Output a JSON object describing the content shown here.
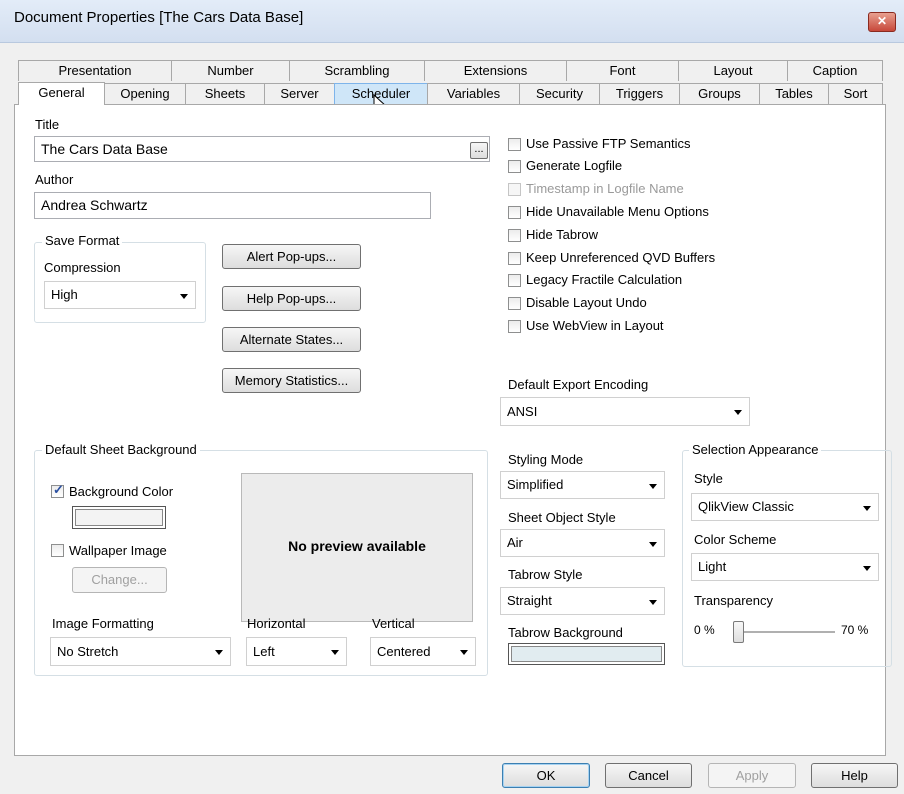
{
  "window": {
    "title": "Document Properties [The Cars Data Base]",
    "close_label": "✕"
  },
  "tabs_row1": [
    "Presentation",
    "Number",
    "Scrambling",
    "Extensions",
    "Font",
    "Layout",
    "Caption"
  ],
  "tabs_row2": [
    "General",
    "Opening",
    "Sheets",
    "Server",
    "Scheduler",
    "Variables",
    "Security",
    "Triggers",
    "Groups",
    "Tables",
    "Sort"
  ],
  "active_tab": "General",
  "hover_tab": "Scheduler",
  "general": {
    "title_label": "Title",
    "title_value": "The Cars Data Base",
    "browse_label": "...",
    "author_label": "Author",
    "author_value": "Andrea Schwartz",
    "save_format": {
      "legend": "Save Format",
      "compression_label": "Compression",
      "compression_value": "High"
    },
    "buttons": {
      "alert": "Alert Pop-ups...",
      "help": "Help Pop-ups...",
      "alternate": "Alternate States...",
      "memory": "Memory Statistics..."
    },
    "options": [
      {
        "label": "Use Passive FTP Semantics",
        "checked": false,
        "enabled": true
      },
      {
        "label": "Generate Logfile",
        "checked": false,
        "enabled": true
      },
      {
        "label": "Timestamp in Logfile Name",
        "checked": false,
        "enabled": false
      },
      {
        "label": "Hide Unavailable Menu Options",
        "checked": false,
        "enabled": true
      },
      {
        "label": "Hide Tabrow",
        "checked": false,
        "enabled": true
      },
      {
        "label": "Keep Unreferenced QVD Buffers",
        "checked": false,
        "enabled": true
      },
      {
        "label": "Legacy Fractile Calculation",
        "checked": false,
        "enabled": true
      },
      {
        "label": "Disable Layout Undo",
        "checked": false,
        "enabled": true
      },
      {
        "label": "Use WebView in Layout",
        "checked": false,
        "enabled": true
      }
    ],
    "export_encoding": {
      "label": "Default Export Encoding",
      "value": "ANSI"
    },
    "sheet_background": {
      "legend": "Default Sheet Background",
      "bg_color_label": "Background Color",
      "bg_color_checked": true,
      "wallpaper_label": "Wallpaper Image",
      "wallpaper_checked": false,
      "change_label": "Change...",
      "preview_text": "No preview available",
      "image_formatting_label": "Image Formatting",
      "image_formatting_value": "No Stretch",
      "horizontal_label": "Horizontal",
      "horizontal_value": "Left",
      "vertical_label": "Vertical",
      "vertical_value": "Centered"
    },
    "styling": {
      "styling_mode_label": "Styling Mode",
      "styling_mode_value": "Simplified",
      "sheet_object_style_label": "Sheet Object Style",
      "sheet_object_style_value": "Air",
      "tabrow_style_label": "Tabrow Style",
      "tabrow_style_value": "Straight",
      "tabrow_background_label": "Tabrow Background",
      "tabrow_background_color": "#e1ecf0"
    },
    "selection_appearance": {
      "legend": "Selection Appearance",
      "style_label": "Style",
      "style_value": "QlikView Classic",
      "color_scheme_label": "Color Scheme",
      "color_scheme_value": "Light",
      "transparency_label": "Transparency",
      "transparency_min": "0 %",
      "transparency_max": "70 %",
      "transparency_value": 0
    }
  },
  "footer": {
    "ok": "OK",
    "cancel": "Cancel",
    "apply": "Apply",
    "help": "Help"
  }
}
